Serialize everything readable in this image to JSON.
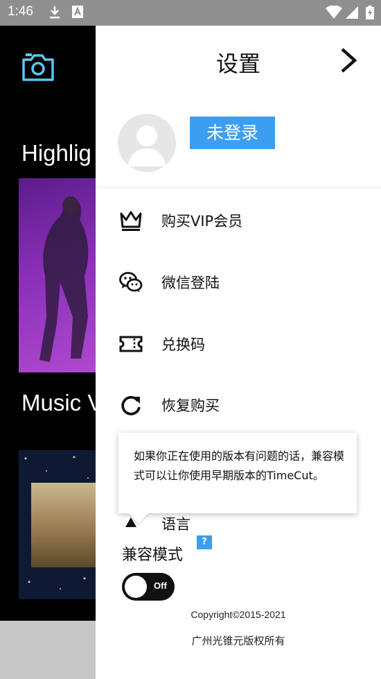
{
  "status_bar": {
    "time": "1:46",
    "icons": [
      "download-icon",
      "text-a-icon",
      "wifi-icon",
      "signal-icon",
      "battery-icon"
    ]
  },
  "background": {
    "section1_title": "Highlig",
    "section2_title": "Music V"
  },
  "drawer": {
    "title": "设置",
    "login_badge": "未登录",
    "menu": [
      {
        "icon": "crown-icon",
        "label": "购买VIP会员"
      },
      {
        "icon": "wechat-icon",
        "label": "微信登陆"
      },
      {
        "icon": "ticket-icon",
        "label": "兑换码"
      },
      {
        "icon": "restore-icon",
        "label": "恢复购买"
      },
      {
        "icon": "language-icon",
        "label": "语言"
      }
    ],
    "tooltip_text": "如果你正在使用的版本有问题的话，兼容模式可以让你使用早期版本的TimeCut。",
    "compat_label": "兼容模式",
    "help_badge": "?",
    "toggle_state": "Off",
    "copyright": "Copyright©2015-2021",
    "company": "广州光锥元版权所有"
  },
  "colors": {
    "accent": "#3d9ef0",
    "status_bar": "#8f8f8f",
    "camera_icon": "#5bc8f0"
  }
}
